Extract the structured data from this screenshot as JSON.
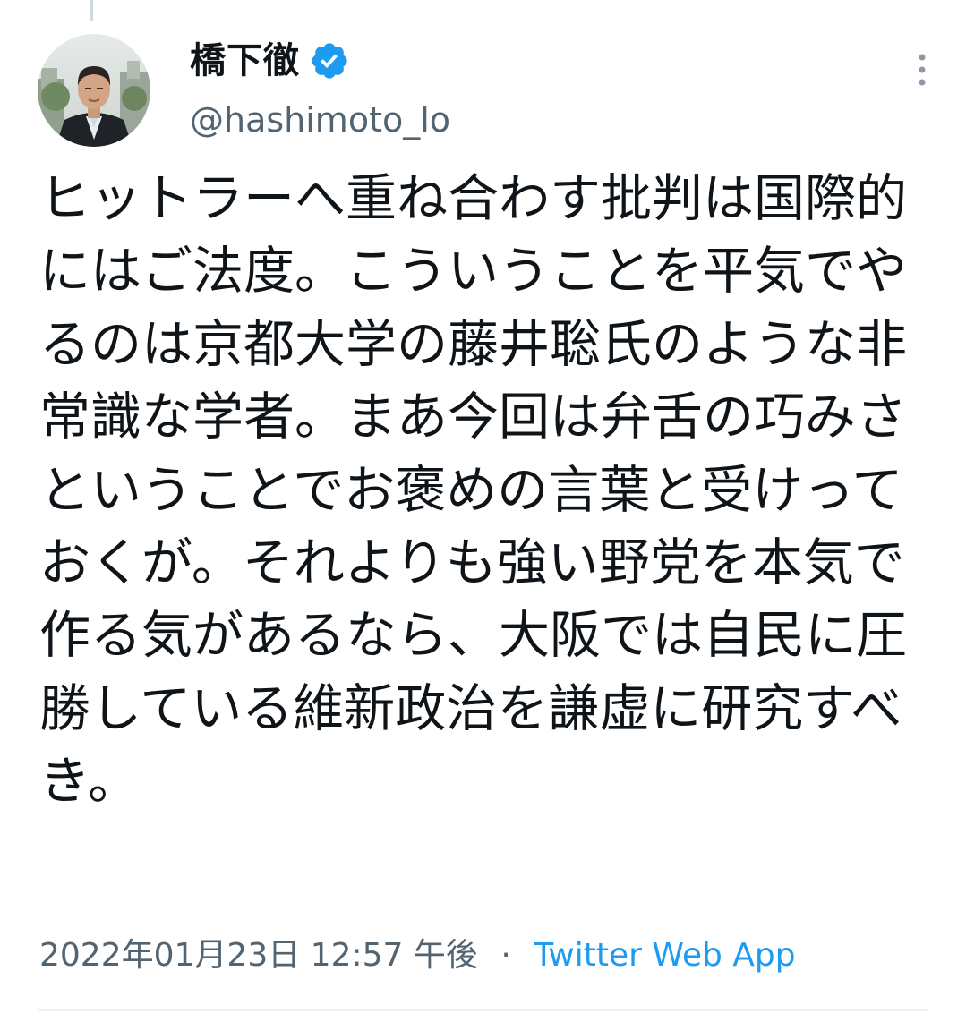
{
  "tweet": {
    "author": {
      "display_name": "橋下徹",
      "handle": "@hashimoto_lo",
      "verified": true
    },
    "text": "ヒットラーへ重ね合わす批判は国際的にはご法度。こういうことを平気でやるのは京都大学の藤井聡氏のような非常識な学者。まあ今回は弁舌の巧みさということでお褒めの言葉と受けっておくが。それよりも強い野党を本気で作る気があるなら、大阪では自民に圧勝している維新政治を謙虚に研究すべき。",
    "timestamp": "2022年01月23日 12:57 午後",
    "separator": "·",
    "source": "Twitter Web App"
  },
  "colors": {
    "text": "#0f1419",
    "secondary": "#536471",
    "accent": "#1d9bf0",
    "divider": "#eff3f4"
  },
  "icons": {
    "verified": "verified-badge-icon",
    "more": "more-vertical-icon"
  }
}
